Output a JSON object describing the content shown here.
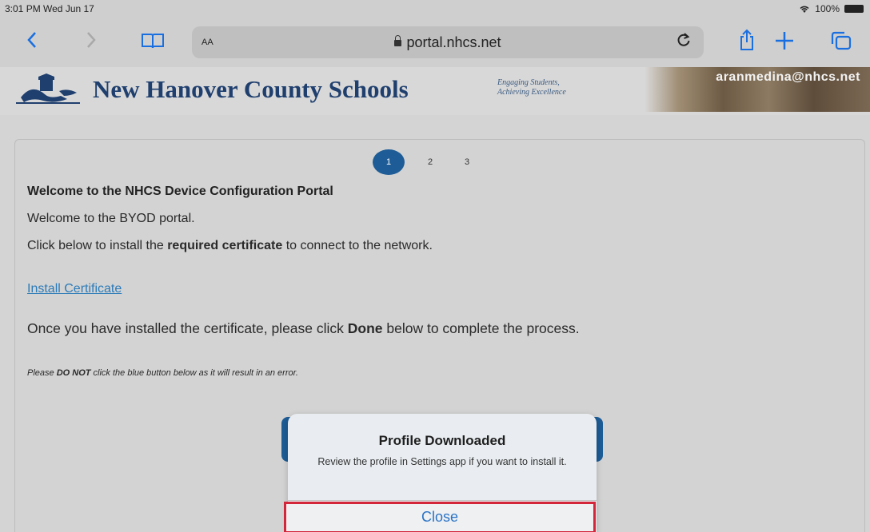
{
  "status_bar": {
    "time": "3:01 PM  Wed Jun 17",
    "battery": "100%",
    "wifi_icon": "wifi-icon"
  },
  "toolbar": {
    "back_icon": "chevron-left-icon",
    "forward_icon": "chevron-right-icon",
    "bookmarks_icon": "book-icon",
    "text_size_label": "AA",
    "url": "portal.nhcs.net",
    "reload_icon": "reload-icon",
    "share_icon": "share-icon",
    "new_tab_icon": "plus-icon",
    "tabs_icon": "tabs-icon"
  },
  "site": {
    "title": "New Hanover County Schools",
    "tagline_line1": "Engaging Students,",
    "tagline_line2": "Achieving Excellence",
    "user_email": "aranmedina@nhcs.net"
  },
  "steps": [
    "1",
    "2",
    "3"
  ],
  "content": {
    "heading": "Welcome to the NHCS Device Configuration Portal",
    "intro": "Welcome to the BYOD portal.",
    "instruction_prefix": "Click below to install the ",
    "instruction_bold": "required certificate",
    "instruction_suffix": " to connect to the network.",
    "install_link": "Install Certificate",
    "done_prefix": "Once you have installed the certificate, please click ",
    "done_bold": "Done",
    "done_suffix": " below to complete the process.",
    "warning_prefix": "Please ",
    "warning_bold": "DO NOT",
    "warning_suffix": " click the blue button below as it will result in an error."
  },
  "popup": {
    "title": "Profile Downloaded",
    "message": "Review the profile in Settings app if you want to install it.",
    "close_label": "Close"
  },
  "colors": {
    "accent_blue": "#1d5c96",
    "link_blue": "#2b7bb9",
    "highlight_red": "#d3263a"
  }
}
